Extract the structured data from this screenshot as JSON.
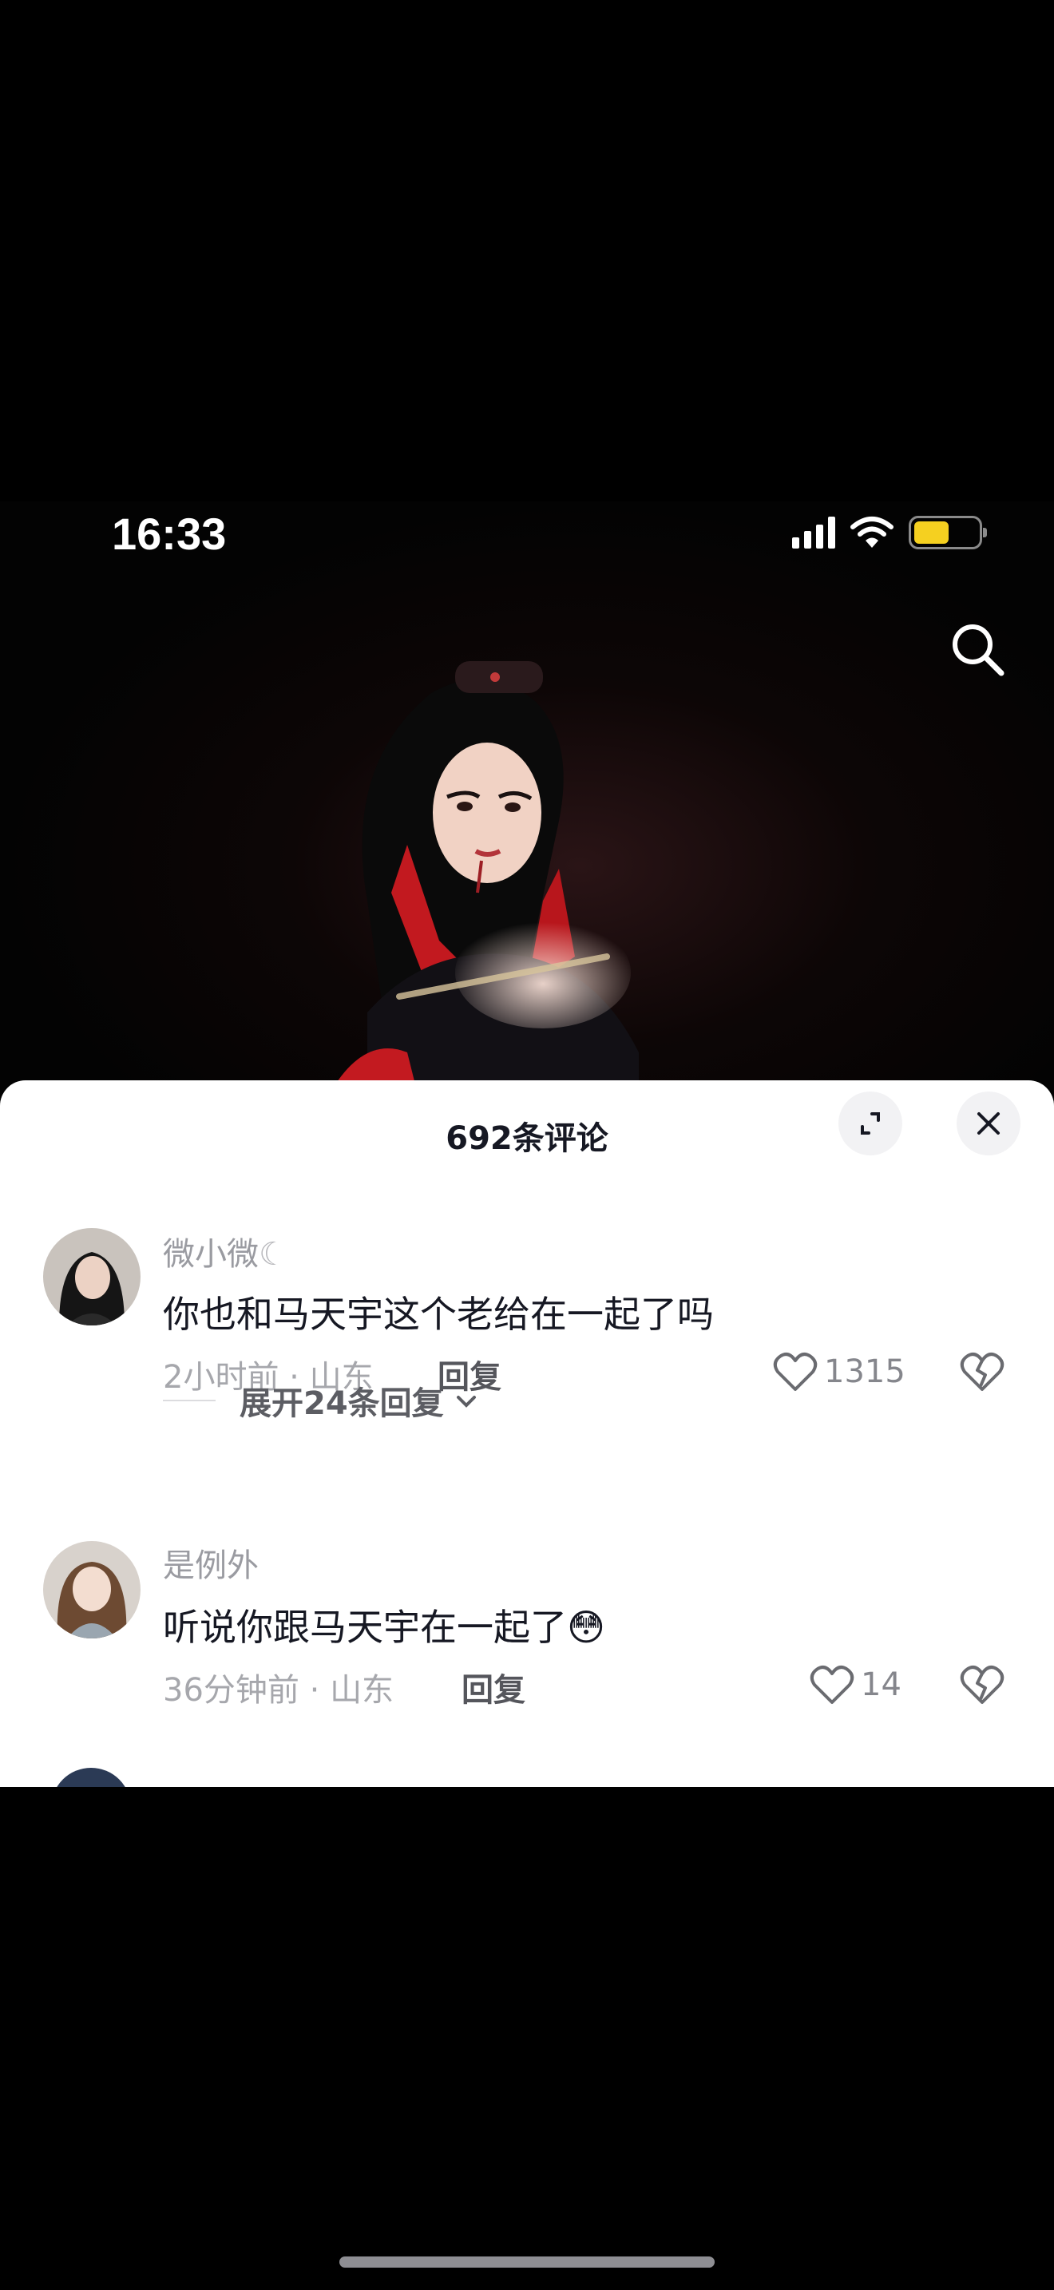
{
  "status_bar": {
    "time": "16:33"
  },
  "comments_sheet": {
    "title": "692条评论",
    "comments": [
      {
        "username": "微小微",
        "username_suffix": "☾",
        "text": "你也和马天宇这个老给在一起了吗",
        "time": "2小时前",
        "location": "山东",
        "reply_label": "回复",
        "likes": "1315"
      },
      {
        "username": "是例外",
        "username_suffix": "",
        "text": "听说你跟马天宇在一起了",
        "emoji": "😳",
        "time": "36分钟前",
        "location": "山东",
        "reply_label": "回复",
        "likes": "14"
      }
    ],
    "expand_replies_label": "展开24条回复"
  },
  "icons": {
    "search": "search-icon",
    "expand": "expand-icon",
    "close": "close-icon",
    "like": "heart-outline-icon",
    "dislike": "broken-heart-icon",
    "chevron": "chevron-down-icon"
  },
  "colors": {
    "battery": "#f5d020",
    "sheet_bg": "#ffffff",
    "primary_text": "#161823",
    "secondary_text": "#a6a7ac"
  }
}
